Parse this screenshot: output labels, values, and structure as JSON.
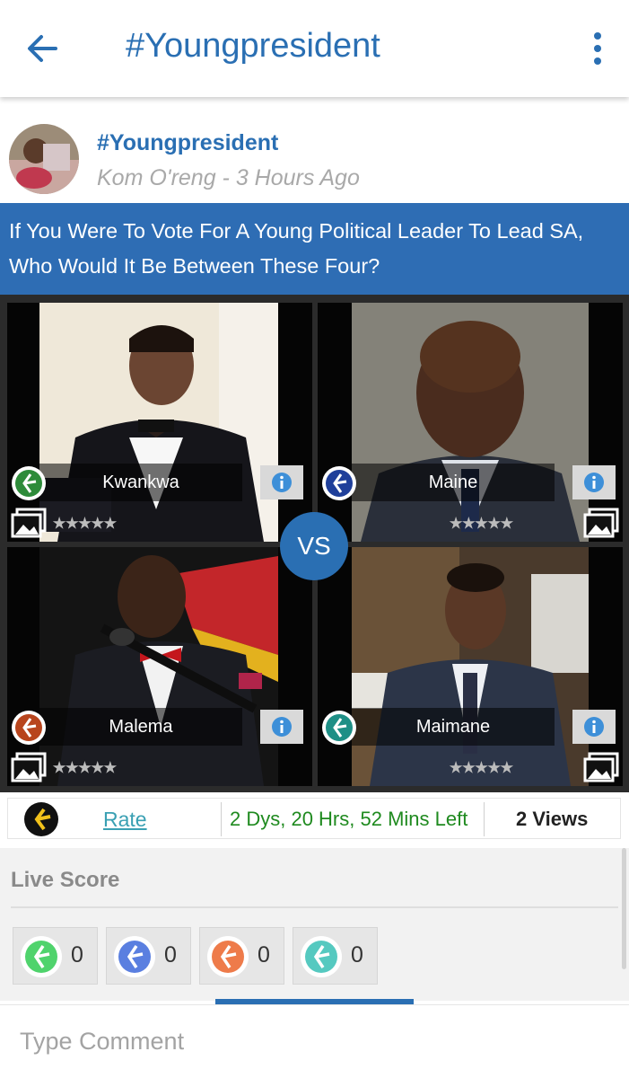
{
  "app_bar": {
    "title": "#Youngpresident"
  },
  "post": {
    "title": "#Youngpresident",
    "meta": "Kom O'reng - 3 Hours Ago",
    "question": "If You Were To Vote For A Young Political Leader To Lead SA, Who Would It Be Between These Four?"
  },
  "contestants": [
    {
      "name": "Kwankwa",
      "badge_color": "#2e8b3a"
    },
    {
      "name": "Maine",
      "badge_color": "#1f3f9a"
    },
    {
      "name": "Malema",
      "badge_color": "#b8451d"
    },
    {
      "name": "Maimane",
      "badge_color": "#1e8f86"
    }
  ],
  "vs_label": "VS",
  "stats": {
    "rate_label": "Rate",
    "time_left": "2 Dys, 20 Hrs, 52 Mins Left",
    "views": "2 Views"
  },
  "live_score": {
    "title": "Live Score",
    "scores": [
      {
        "value": "0",
        "color": "#4fd36c"
      },
      {
        "value": "0",
        "color": "#5a7fe0"
      },
      {
        "value": "0",
        "color": "#ee7b4a"
      },
      {
        "value": "0",
        "color": "#55c9c0"
      }
    ]
  },
  "comment": {
    "placeholder": "Type Comment"
  }
}
